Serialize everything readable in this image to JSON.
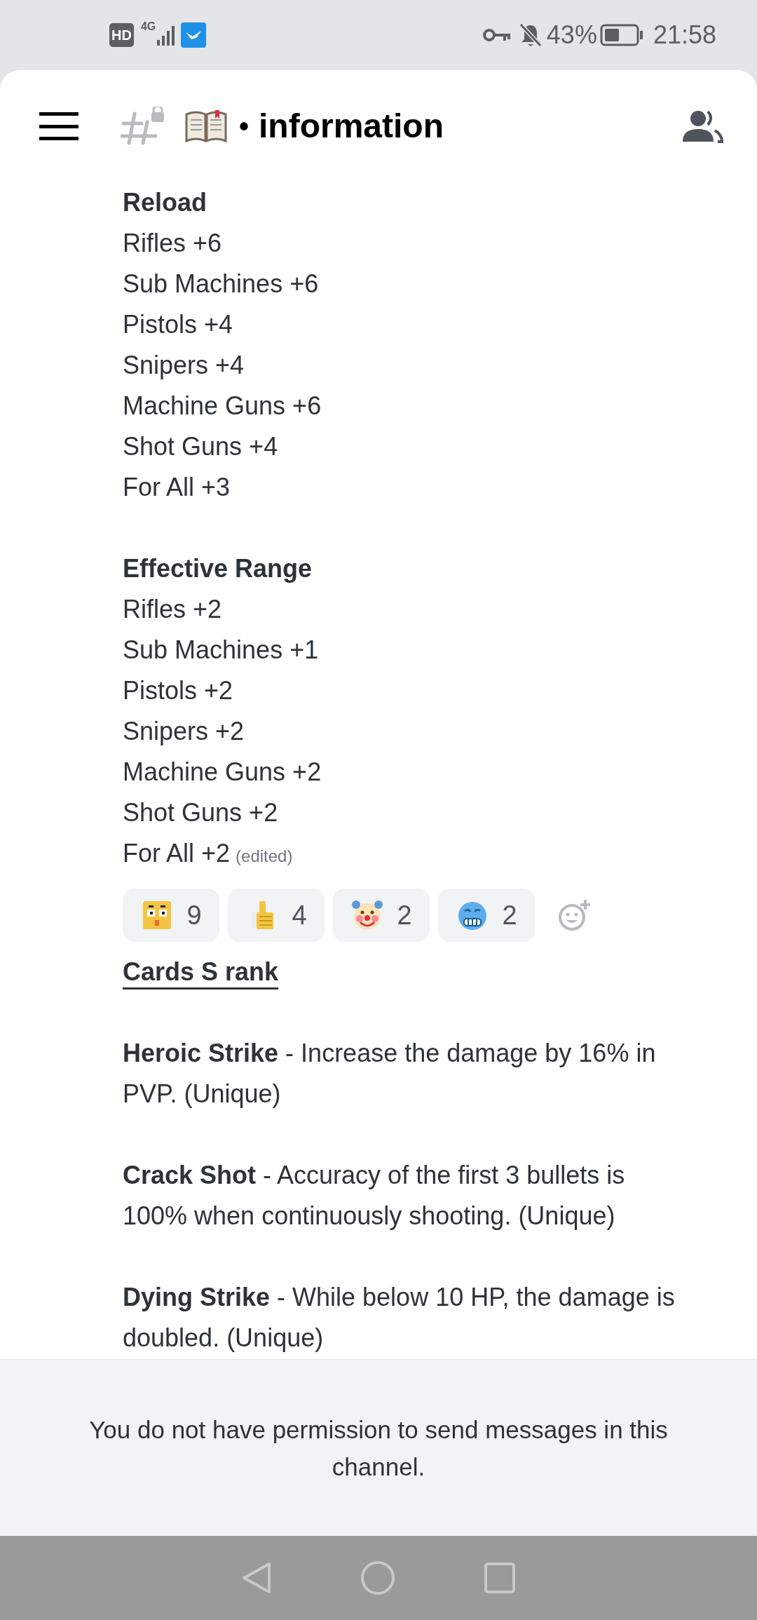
{
  "status_bar": {
    "hd": "HD",
    "network": "4G",
    "battery": "43%",
    "time": "21:58"
  },
  "header": {
    "separator": "•",
    "channel_name": "information"
  },
  "sections": [
    {
      "heading": "Reload",
      "lines": [
        "Rifles +6",
        "Sub Machines +6",
        "Pistols +4",
        "Snipers +4",
        "Machine Guns +6",
        "Shot Guns +4",
        "For All +3"
      ]
    },
    {
      "heading": "Effective Range",
      "lines": [
        "Rifles +2",
        "Sub Machines +1",
        "Pistols +2",
        "Snipers +2",
        "Machine Guns +2",
        "Shot Guns +2",
        "For All +2"
      ],
      "edited": "(edited)"
    }
  ],
  "reactions": [
    {
      "kind": "face",
      "count": "9"
    },
    {
      "kind": "thumbs",
      "count": "4"
    },
    {
      "kind": "clown",
      "count": "2"
    },
    {
      "kind": "cold",
      "count": "2"
    }
  ],
  "cards_heading": "Cards S rank",
  "cards": [
    "**Heroic Strike** - Increase the damage by 16% in PVP. (Unique)",
    "**Crack Shot** - Accuracy of the first 3 bullets is 100% when continuously shooting. (Unique)",
    "**Dying Strike** - While below 10 HP, the damage is doubled. (Unique)"
  ],
  "notice": "You do not have permission to send messages in this channel."
}
